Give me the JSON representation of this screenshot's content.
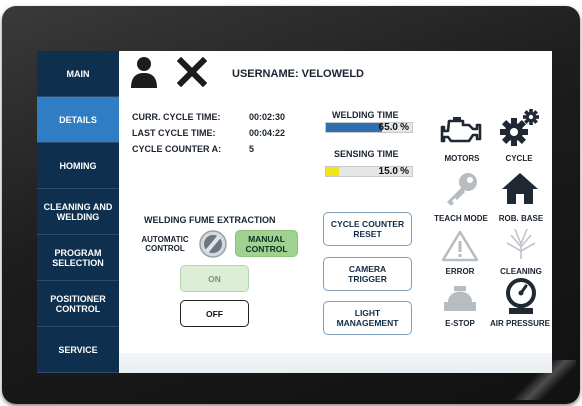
{
  "sidebar": {
    "items": [
      {
        "label": "MAIN",
        "active": false
      },
      {
        "label": "DETAILS",
        "active": true
      },
      {
        "label": "HOMING",
        "active": false
      },
      {
        "label": "CLEANING AND WELDING",
        "active": false
      },
      {
        "label": "PROGRAM SELECTION",
        "active": false
      },
      {
        "label": "POSITIONER CONTROL",
        "active": false
      },
      {
        "label": "SERVICE",
        "active": false
      }
    ]
  },
  "header": {
    "username": "USERNAME: VELOWELD",
    "user_icon": "user-icon",
    "close_icon": "close-icon"
  },
  "cycle_info": {
    "curr_label": "CURR. CYCLE TIME:",
    "curr_value": "00:02:30",
    "last_label": "LAST CYCLE TIME:",
    "last_value": "00:04:22",
    "counter_label": "CYCLE COUNTER A:",
    "counter_value": "5"
  },
  "welding_time": {
    "label": "WELDING TIME",
    "value": "65.0",
    "unit": "%",
    "fraction": 0.65,
    "color": "#2e6fb0"
  },
  "sensing_time": {
    "label": "SENSING TIME",
    "value": "15.0",
    "unit": "%",
    "fraction": 0.15,
    "color": "#f2e31b"
  },
  "fume": {
    "title": "WELDING FUME EXTRACTION",
    "automatic": "AUTOMATIC CONTROL",
    "manual": "MANUAL CONTROL",
    "on": "ON",
    "off": "OFF"
  },
  "actions": {
    "counter_reset": "CYCLE COUNTER RESET",
    "camera_trigger": "CAMERA TRIGGER",
    "light_management": "LIGHT MANAGEMENT"
  },
  "status": {
    "motors": "MOTORS",
    "cycle": "CYCLE",
    "teach_mode": "TEACH MODE",
    "rob_base": "ROB. BASE",
    "error": "ERROR",
    "cleaning": "CLEANING",
    "estop": "E-STOP",
    "air_pressure": "AIR PRESSURE"
  },
  "colors": {
    "nav_bg": "#0f2f4e",
    "nav_active": "#2f7ec5",
    "manual_bg": "#9fd18f",
    "on_bg": "#dcefd6"
  }
}
